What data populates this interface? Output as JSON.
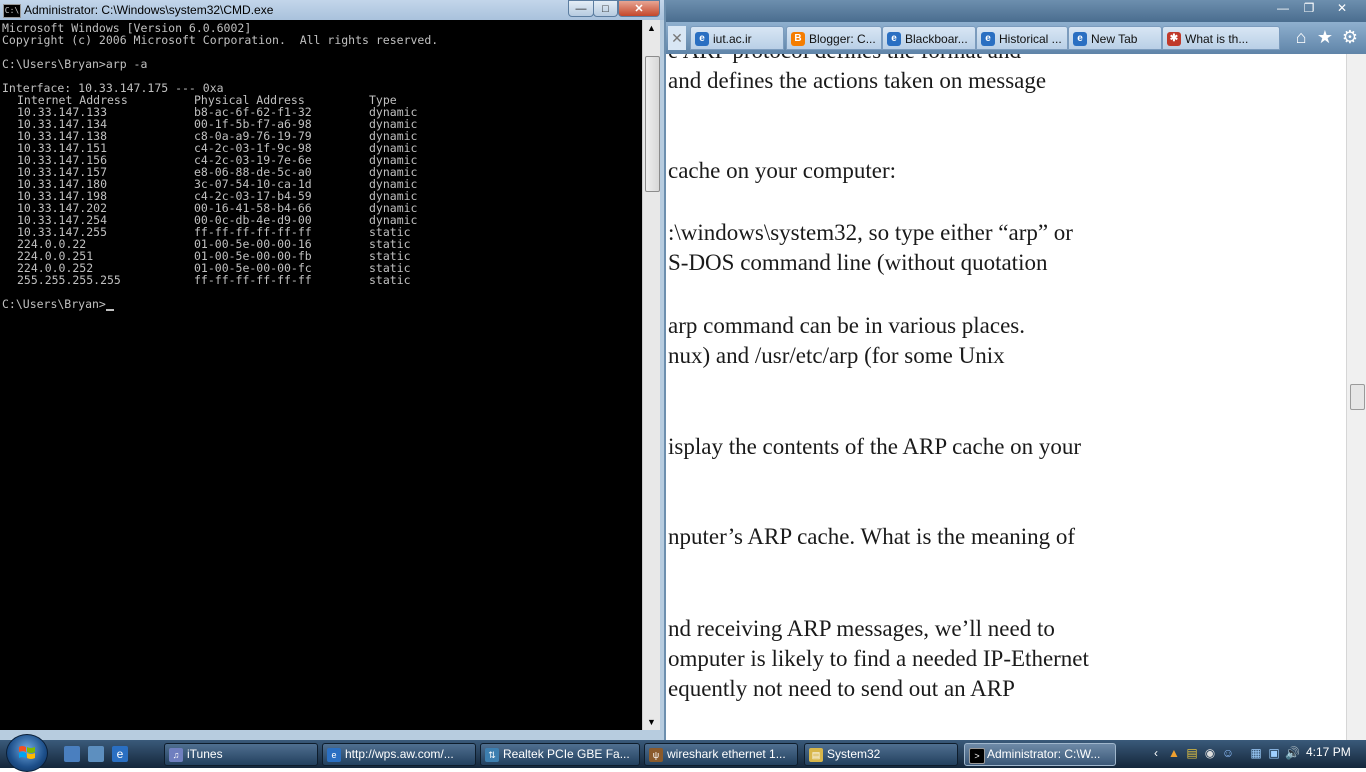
{
  "browser": {
    "tabs": [
      {
        "label": "iut.ac.ir",
        "icon": "ie-icon"
      },
      {
        "label": "Blogger: C...",
        "icon": "blogger-icon"
      },
      {
        "label": "Blackboar...",
        "icon": "ie-icon"
      },
      {
        "label": "Historical ...",
        "icon": "ie-icon"
      },
      {
        "label": "New Tab",
        "icon": "ie-icon"
      },
      {
        "label": "What is th...",
        "icon": "joomla-icon"
      }
    ],
    "document_lines": [
      "e ARP protocol defines the format and",
      "and defines the actions taken on message",
      "cache on your computer:",
      ":\\windows\\system32, so type either “arp” or",
      "S-DOS command line (without quotation",
      "arp command can be in various places.",
      "nux) and /usr/etc/arp (for some Unix",
      "isplay the contents of the ARP cache on your",
      "nputer’s ARP cache.  What is the meaning of",
      "nd receiving ARP messages, we’ll need to",
      "omputer is likely to find a needed IP-Ethernet",
      "equently not need to send out an ARP"
    ]
  },
  "cmd": {
    "title": "Administrator: C:\\Windows\\system32\\CMD.exe",
    "header_line1": "Microsoft Windows [Version 6.0.6002]",
    "header_line2": "Copyright (c) 2006 Microsoft Corporation.  All rights reserved.",
    "prompt_command": "C:\\Users\\Bryan>arp -a",
    "interface_line": "Interface: 10.33.147.175 --- 0xa",
    "columns": [
      "Internet Address",
      "Physical Address",
      "Type"
    ],
    "rows": [
      [
        "10.33.147.133",
        "b8-ac-6f-62-f1-32",
        "dynamic"
      ],
      [
        "10.33.147.134",
        "00-1f-5b-f7-a6-98",
        "dynamic"
      ],
      [
        "10.33.147.138",
        "c8-0a-a9-76-19-79",
        "dynamic"
      ],
      [
        "10.33.147.151",
        "c4-2c-03-1f-9c-98",
        "dynamic"
      ],
      [
        "10.33.147.156",
        "c4-2c-03-19-7e-6e",
        "dynamic"
      ],
      [
        "10.33.147.157",
        "e8-06-88-de-5c-a0",
        "dynamic"
      ],
      [
        "10.33.147.180",
        "3c-07-54-10-ca-1d",
        "dynamic"
      ],
      [
        "10.33.147.198",
        "c4-2c-03-17-b4-59",
        "dynamic"
      ],
      [
        "10.33.147.202",
        "00-16-41-58-b4-66",
        "dynamic"
      ],
      [
        "10.33.147.254",
        "00-0c-db-4e-d9-00",
        "dynamic"
      ],
      [
        "10.33.147.255",
        "ff-ff-ff-ff-ff-ff",
        "static"
      ],
      [
        "224.0.0.22",
        "01-00-5e-00-00-16",
        "static"
      ],
      [
        "224.0.0.251",
        "01-00-5e-00-00-fb",
        "static"
      ],
      [
        "224.0.0.252",
        "01-00-5e-00-00-fc",
        "static"
      ],
      [
        "255.255.255.255",
        "ff-ff-ff-ff-ff-ff",
        "static"
      ]
    ],
    "final_prompt": "C:\\Users\\Bryan>"
  },
  "taskbar": {
    "buttons": [
      {
        "label": "iTunes",
        "icon": "itunes-icon"
      },
      {
        "label": "http://wps.aw.com/...",
        "icon": "ie-icon"
      },
      {
        "label": "Realtek PCIe GBE Fa...",
        "icon": "network-icon"
      },
      {
        "label": "wireshark ethernet 1...",
        "icon": "wireshark-icon"
      },
      {
        "label": "System32",
        "icon": "folder-icon"
      },
      {
        "label": "Administrator: C:\\W...",
        "icon": "cmd-icon"
      }
    ],
    "clock": "4:17 PM"
  },
  "colors": {
    "console_bg": "#000000",
    "console_text": "#c0c0c0",
    "title_bar": "#b7ccdf",
    "taskbar": "#1a2f46"
  }
}
